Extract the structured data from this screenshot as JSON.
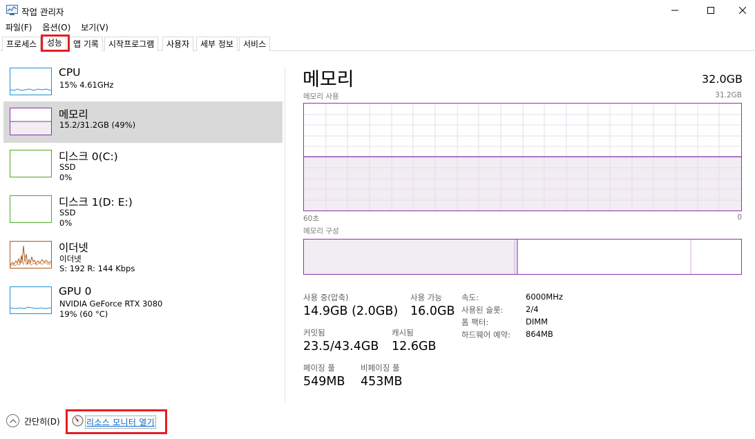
{
  "window": {
    "title": "작업 관리자",
    "controls": {
      "minimize": "─",
      "maximize": "☐",
      "close": "✕"
    }
  },
  "menu": [
    "파일(F)",
    "옵션(O)",
    "보기(V)"
  ],
  "tabs": [
    {
      "label": "프로세스",
      "active": false
    },
    {
      "label": "성능",
      "active": true
    },
    {
      "label": "앱 기록",
      "active": false
    },
    {
      "label": "시작프로그램",
      "active": false
    },
    {
      "label": "사용자",
      "active": false
    },
    {
      "label": "세부 정보",
      "active": false
    },
    {
      "label": "서비스",
      "active": false
    }
  ],
  "perf_items": [
    {
      "title": "CPU",
      "sub1": "15% 4.61GHz",
      "sub2": "",
      "color": "#1e8fd6",
      "selected": false,
      "icon": "cpu-graph-icon"
    },
    {
      "title": "메모리",
      "sub1": "15.2/31.2GB (49%)",
      "sub2": "",
      "color": "#8b2fad",
      "selected": true,
      "icon": "memory-graph-icon"
    },
    {
      "title": "디스크 0(C:)",
      "sub1": "SSD",
      "sub2": "0%",
      "color": "#4da626",
      "selected": false,
      "icon": "disk-graph-icon"
    },
    {
      "title": "디스크 1(D: E:)",
      "sub1": "SSD",
      "sub2": "0%",
      "color": "#4da626",
      "selected": false,
      "icon": "disk-graph-icon"
    },
    {
      "title": "이더넷",
      "sub1": "이더넷",
      "sub2": "S: 192  R: 144 Kbps",
      "color": "#a7581d",
      "selected": false,
      "icon": "ethernet-graph-icon"
    },
    {
      "title": "GPU 0",
      "sub1": "NVIDIA GeForce RTX 3080",
      "sub2": "19% (60 °C)",
      "color": "#1e8fd6",
      "selected": false,
      "icon": "gpu-graph-icon"
    }
  ],
  "memory": {
    "title": "메모리",
    "total": "32.0GB",
    "usage_label": "메모리 사용",
    "usage_max": "31.2GB",
    "time_left": "60초",
    "time_right": "0",
    "usage_fraction": 0.49,
    "composition_label": "메모리 구성",
    "stats": {
      "in_use_label": "사용 중(압축)",
      "in_use_value": "14.9GB (2.0GB)",
      "available_label": "사용 가능",
      "available_value": "16.0GB",
      "committed_label": "커밋됨",
      "committed_value": "23.5/43.4GB",
      "cached_label": "캐시됨",
      "cached_value": "12.6GB",
      "paged_label": "페이징 풀",
      "paged_value": "549MB",
      "nonpaged_label": "비페이징 풀",
      "nonpaged_value": "453MB"
    },
    "specs": [
      {
        "label": "속도:",
        "value": "6000MHz"
      },
      {
        "label": "사용된 슬롯:",
        "value": "2/4"
      },
      {
        "label": "폼 팩터:",
        "value": "DIMM"
      },
      {
        "label": "하드웨어 예약:",
        "value": "864MB"
      }
    ]
  },
  "bottom": {
    "fewer_details": "간단히(D)",
    "resource_monitor": "리소스 모니터 열기"
  },
  "colors": {
    "memory": "#8b2fad",
    "highlight": "#e31d22",
    "link": "#0066cc"
  }
}
